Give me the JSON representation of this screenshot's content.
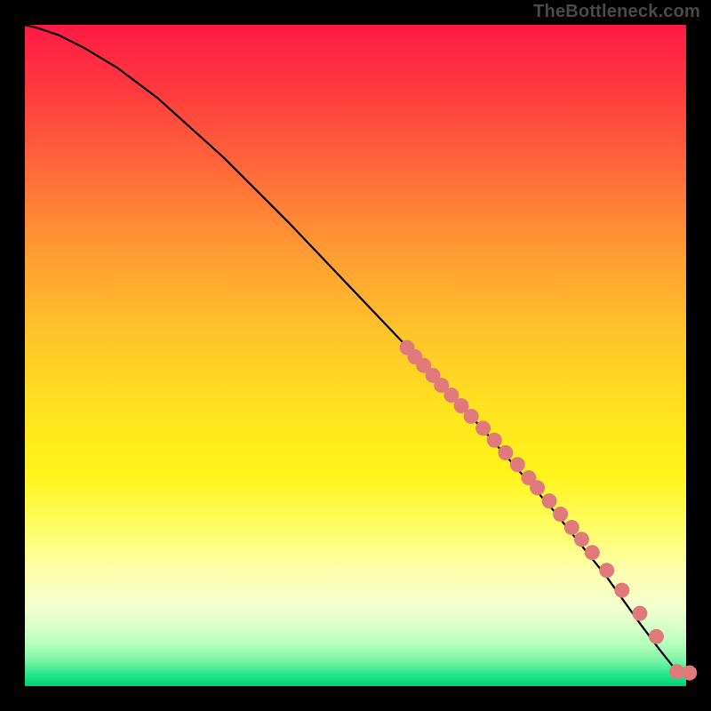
{
  "attribution": "TheBottleneck.com",
  "colors": {
    "curve": "#000000",
    "marker_fill": "#e07a7a",
    "marker_stroke": "#c96565"
  },
  "chart_data": {
    "type": "line",
    "title": "",
    "xlabel": "",
    "ylabel": "",
    "xlim": [
      0,
      1
    ],
    "ylim": [
      0,
      1
    ],
    "background": "red-yellow-green-vertical-gradient",
    "series": [
      {
        "name": "curve",
        "kind": "line",
        "x": [
          0.0,
          0.02,
          0.05,
          0.09,
          0.14,
          0.2,
          0.3,
          0.4,
          0.5,
          0.6,
          0.7,
          0.8,
          0.88,
          0.93,
          0.96,
          0.98,
          0.995,
          1.0
        ],
        "y": [
          1.0,
          0.995,
          0.985,
          0.965,
          0.935,
          0.89,
          0.8,
          0.7,
          0.595,
          0.49,
          0.38,
          0.265,
          0.165,
          0.095,
          0.055,
          0.03,
          0.018,
          0.017
        ]
      },
      {
        "name": "markers",
        "kind": "scatter",
        "x": [
          0.578,
          0.59,
          0.603,
          0.617,
          0.63,
          0.645,
          0.66,
          0.675,
          0.693,
          0.71,
          0.727,
          0.745,
          0.762,
          0.775,
          0.793,
          0.81,
          0.827,
          0.842,
          0.858,
          0.88,
          0.903,
          0.93,
          0.955,
          0.986,
          1.005
        ],
        "y": [
          0.512,
          0.498,
          0.485,
          0.47,
          0.455,
          0.44,
          0.424,
          0.408,
          0.39,
          0.372,
          0.353,
          0.335,
          0.315,
          0.3,
          0.28,
          0.26,
          0.24,
          0.222,
          0.202,
          0.175,
          0.145,
          0.11,
          0.075,
          0.022,
          0.02
        ]
      }
    ]
  }
}
